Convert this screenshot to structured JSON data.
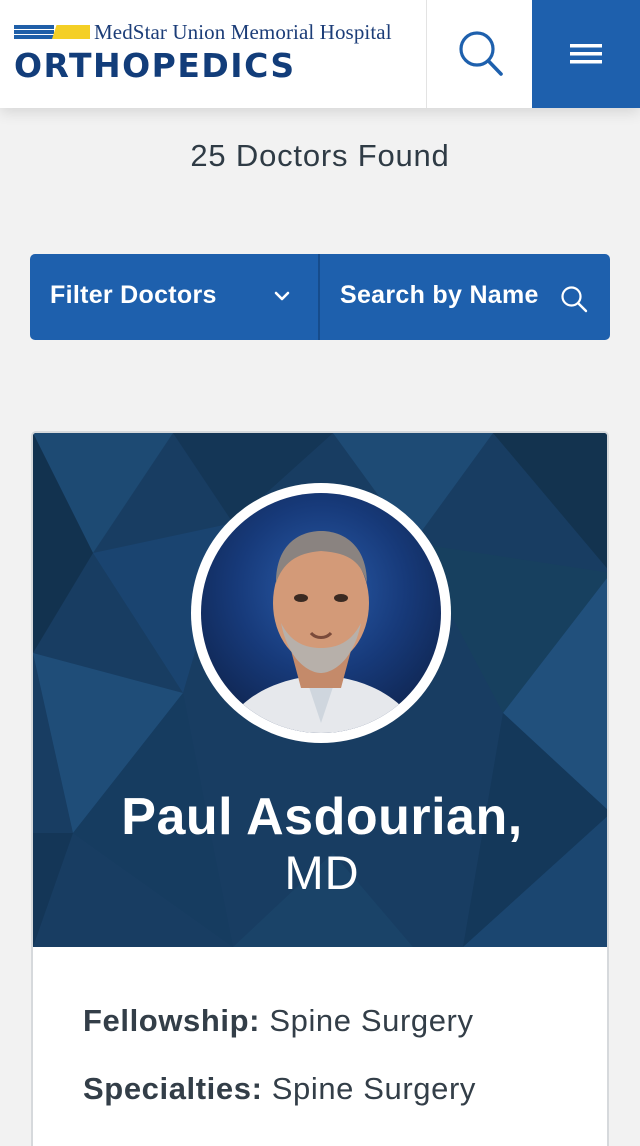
{
  "header": {
    "org_name": "MedStar Union Memorial Hospital",
    "department": "ORTHOPEDICS",
    "search_icon": "search-icon",
    "menu_icon": "hamburger-menu-icon"
  },
  "results": {
    "count_text": "25 Doctors Found"
  },
  "filterbar": {
    "filter_label": "Filter Doctors",
    "filter_icon": "chevron-down-icon",
    "search_label": "Search by Name",
    "search_icon": "search-icon"
  },
  "doctor": {
    "name": "Paul Asdourian,",
    "credential": "MD",
    "fellowship_key": "Fellowship:",
    "fellowship_value": "Spine Surgery",
    "specialties_key": "Specialties:",
    "specialties_value": "Spine Surgery"
  },
  "colors": {
    "brand_blue": "#1e60ad",
    "navy": "#123d7a",
    "hero_bg": "#163a5f",
    "accent_yellow": "#f4cf25"
  }
}
